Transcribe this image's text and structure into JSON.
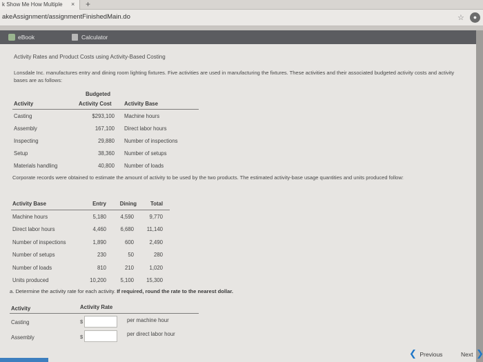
{
  "browser": {
    "tab_title": "k Show Me How Multiple",
    "tab_close": "×",
    "new_tab": "+",
    "url": "akeAssignment/assignmentFinishedMain.do"
  },
  "toolbar": {
    "ebook_label": "eBook",
    "calculator_label": "Calculator"
  },
  "problem": {
    "title": "Activity Rates and Product Costs using Activity-Based Costing",
    "intro": "Lonsdale Inc. manufactures entry and dining room lighting fixtures. Five activities are used in manufacturing the fixtures. These activities and their associated budgeted activity costs and activity bases are as follows:",
    "table1": {
      "headers": {
        "activity": "Activity",
        "budgeted": "Budgeted",
        "activity_cost": "Activity Cost",
        "activity_base": "Activity Base"
      },
      "rows": [
        {
          "activity": "Casting",
          "cost": "$293,100",
          "base": "Machine hours"
        },
        {
          "activity": "Assembly",
          "cost": "167,100",
          "base": "Direct labor hours"
        },
        {
          "activity": "Inspecting",
          "cost": "29,880",
          "base": "Number of inspections"
        },
        {
          "activity": "Setup",
          "cost": "38,360",
          "base": "Number of setups"
        },
        {
          "activity": "Materials handling",
          "cost": "40,800",
          "base": "Number of loads"
        }
      ]
    },
    "corporate_text": "Corporate records were obtained to estimate the amount of activity to be used by the two products. The estimated activity-base usage quantities and units produced follow:",
    "table2": {
      "headers": {
        "activity_base": "Activity Base",
        "entry": "Entry",
        "dining": "Dining",
        "total": "Total"
      },
      "rows": [
        {
          "base": "Machine hours",
          "entry": "5,180",
          "dining": "4,590",
          "total": "9,770"
        },
        {
          "base": "Direct labor hours",
          "entry": "4,460",
          "dining": "6,680",
          "total": "11,140"
        },
        {
          "base": "Number of inspections",
          "entry": "1,890",
          "dining": "600",
          "total": "2,490"
        },
        {
          "base": "Number of setups",
          "entry": "230",
          "dining": "50",
          "total": "280"
        },
        {
          "base": "Number of loads",
          "entry": "810",
          "dining": "210",
          "total": "1,020"
        },
        {
          "base": "Units produced",
          "entry": "10,200",
          "dining": "5,100",
          "total": "15,300"
        }
      ]
    },
    "question_a_prefix": "a.  Determine the activity rate for each activity.",
    "question_a_bold": "If required, round the rate to the nearest dollar.",
    "answer_table": {
      "headers": {
        "activity": "Activity",
        "activity_rate": "Activity Rate"
      },
      "rows": [
        {
          "activity": "Casting",
          "dollar": "$",
          "value": "",
          "unit": "per machine hour"
        },
        {
          "activity": "Assembly",
          "dollar": "$",
          "value": "",
          "unit": "per direct labor hour"
        }
      ]
    }
  },
  "navigation": {
    "previous": "Previous",
    "next": "Next",
    "prev_chevron": "❮",
    "next_chevron": "❯"
  },
  "colors": {
    "link_blue": "#1f77c8",
    "content_bar": "#5b5c60"
  }
}
